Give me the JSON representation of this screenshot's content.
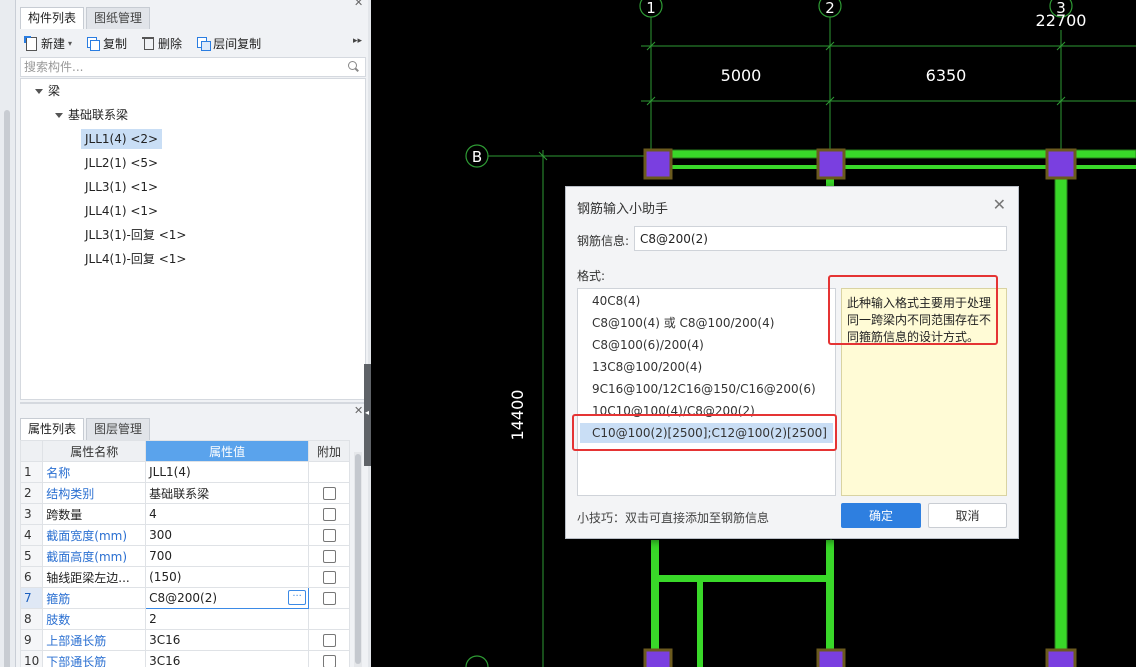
{
  "left_panel": {
    "top_tabs": [
      "构件列表",
      "图纸管理"
    ],
    "toolbar": {
      "new_label": "新建",
      "copy_label": "复制",
      "delete_label": "删除",
      "layer_copy_label": "层间复制",
      "more_glyph": "▸▸"
    },
    "search_placeholder": "搜索构件...",
    "tree": {
      "root": "梁",
      "group": "基础联系梁",
      "items": [
        "JLL1(4) <2>",
        "JLL2(1) <5>",
        "JLL3(1) <1>",
        "JLL4(1) <1>",
        "JLL3(1)-回复 <1>",
        "JLL4(1)-回复 <1>"
      ],
      "selected_index": 0
    },
    "bottom_tabs": [
      "属性列表",
      "图层管理"
    ],
    "prop_table": {
      "headers": [
        "属性名称",
        "属性值",
        "附加"
      ],
      "rows": [
        {
          "idx": "1",
          "name": "名称",
          "value": "JLL1(4)",
          "blue": true,
          "checkbox": false
        },
        {
          "idx": "2",
          "name": "结构类别",
          "value": "基础联系梁",
          "blue": true,
          "checkbox": true
        },
        {
          "idx": "3",
          "name": "跨数量",
          "value": "4",
          "blue": false,
          "checkbox": true
        },
        {
          "idx": "4",
          "name": "截面宽度(mm)",
          "value": "300",
          "blue": true,
          "checkbox": true
        },
        {
          "idx": "5",
          "name": "截面高度(mm)",
          "value": "700",
          "blue": true,
          "checkbox": true
        },
        {
          "idx": "6",
          "name": "轴线距梁左边...",
          "value": "(150)",
          "blue": false,
          "checkbox": true
        },
        {
          "idx": "7",
          "name": "箍筋",
          "value": "C8@200(2)",
          "blue": true,
          "checkbox": true
        },
        {
          "idx": "8",
          "name": "肢数",
          "value": "2",
          "blue": true,
          "checkbox": false
        },
        {
          "idx": "9",
          "name": "上部通长筋",
          "value": "3C16",
          "blue": true,
          "checkbox": true
        },
        {
          "idx": "10",
          "name": "下部通长筋",
          "value": "3C16",
          "blue": true,
          "checkbox": true
        }
      ],
      "editing_row": 6,
      "ellipsis": "···"
    }
  },
  "cad": {
    "axis_labels": [
      "1",
      "2",
      "3"
    ],
    "row_axis_label": "B",
    "total_dim": "22700",
    "dims": [
      "5000",
      "6350"
    ],
    "vertical_dim": "14400",
    "colors": {
      "beam": "#39d829",
      "column": "#7a3fe0",
      "column_border": "#6b5a1e",
      "axis_line": "#2e9a34",
      "dim_line": "#2e9a34"
    }
  },
  "dialog": {
    "title": "钢筋输入小助手",
    "close_glyph": "✕",
    "rebar_label": "钢筋信息:",
    "rebar_value": "C8@200(2)",
    "format_label": "格式:",
    "formats": [
      "40C8(4)",
      "C8@100(4) 或 C8@100/200(4)",
      "C8@100(6)/200(4)",
      "13C8@100/200(4)",
      "9C16@100/12C16@150/C16@200(6)",
      "10C10@100(4)/C8@200(2)",
      "C10@100(2)[2500];C12@100(2)[2500]"
    ],
    "selected_format_index": 6,
    "info_text": "此种输入格式主要用于处理同一跨梁内不同范围存在不同箍筋信息的设计方式。",
    "tip": "小技巧：双击可直接添加至钢筋信息",
    "ok_label": "确定",
    "cancel_label": "取消"
  }
}
